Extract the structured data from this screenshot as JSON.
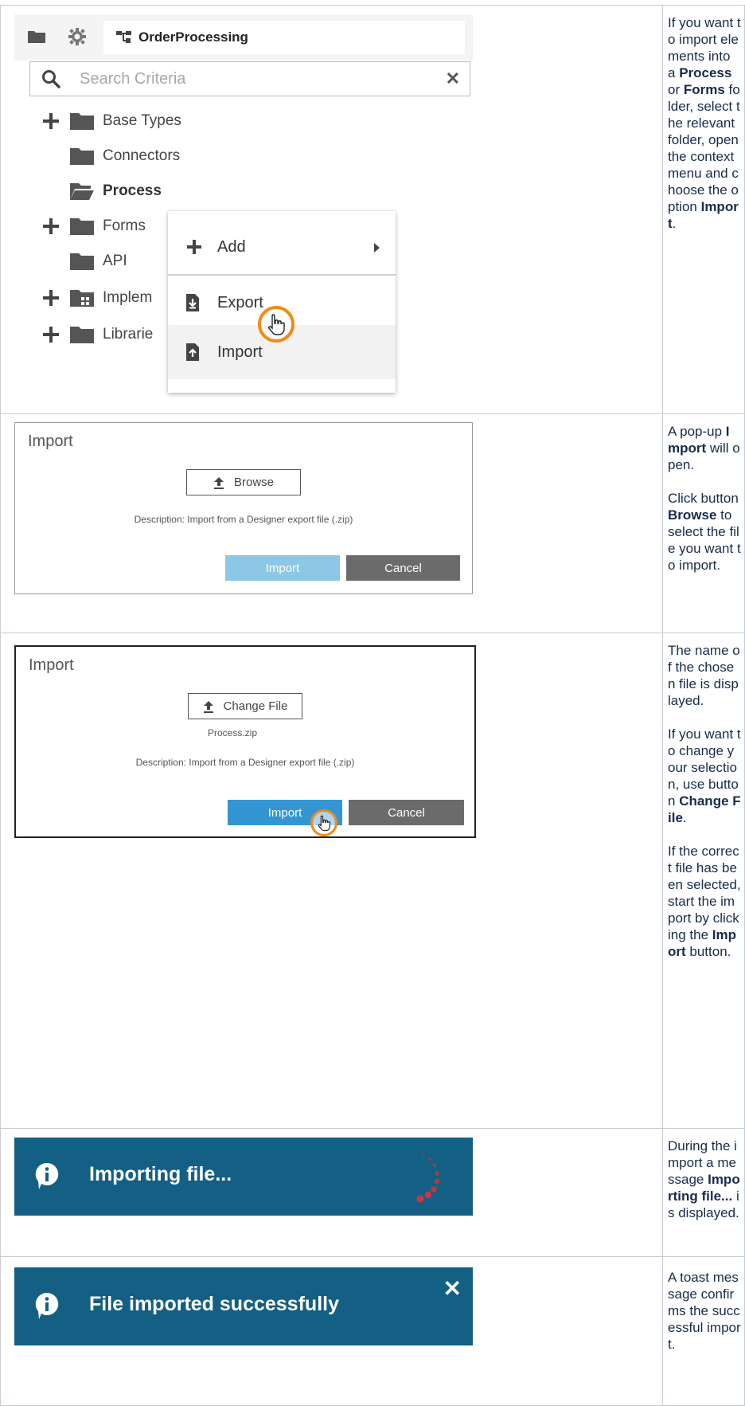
{
  "step1": {
    "tree": {
      "title": "OrderProcessing",
      "search_placeholder": "Search Criteria",
      "items": [
        {
          "label": "Base Types",
          "expandable": true,
          "icon": "folder-icon",
          "bold": false
        },
        {
          "label": "Connectors",
          "expandable": false,
          "icon": "folder-icon",
          "bold": false
        },
        {
          "label": "Process",
          "expandable": false,
          "icon": "folder-open-icon",
          "bold": true
        },
        {
          "label": "Forms",
          "expandable": true,
          "icon": "folder-icon",
          "bold": false
        },
        {
          "label": "API",
          "expandable": false,
          "icon": "folder-icon",
          "bold": false
        },
        {
          "label": "Implem",
          "expandable": true,
          "icon": "folder-grid-icon",
          "bold": false
        },
        {
          "label": "Librarie",
          "expandable": true,
          "icon": "folder-icon",
          "bold": false
        }
      ]
    },
    "context_menu": {
      "add_label": "Add",
      "export_label": "Export",
      "import_label": "Import"
    },
    "description": {
      "t1": "If you want to import elements into a ",
      "b1": "Process",
      "t2": " or ",
      "b2": "Forms",
      "t3": " folder, select the relevant folder, open the context menu and choose the option ",
      "b3": "Import",
      "t4": "."
    }
  },
  "step2": {
    "dialog": {
      "title": "Import",
      "browse_label": "Browse",
      "description_text": "Description: Import from a Designer export file (.zip)",
      "import_label": "Import",
      "cancel_label": "Cancel"
    },
    "description": {
      "t1": "A pop-up ",
      "b1": "Import",
      "t2": " will open.",
      "t3": "Click button ",
      "b2": "Browse",
      "t4": " to select the file you want to import."
    }
  },
  "step3": {
    "dialog": {
      "title": "Import",
      "change_label": "Change File",
      "file_name": "Process.zip",
      "description_text": "Description: Import from a Designer export file (.zip)",
      "import_label": "Import",
      "cancel_label": "Cancel"
    },
    "description": {
      "p1": "The name of the chosen file is displayed.",
      "t2": "If you want to change your selection, use button ",
      "b2": "Change File",
      "t3": ".",
      "t4": "If the correct file has been selected, start the import by clicking the ",
      "b4": "Import",
      "t5": " button."
    }
  },
  "step4": {
    "toast": {
      "message": "Importing file..."
    },
    "description": {
      "t1": "During the import a message ",
      "b1": "Importing file...",
      "t2": " is displayed."
    }
  },
  "step5": {
    "toast": {
      "message": "File imported successfully"
    },
    "description": {
      "t1": "A toast message confirms the successful import."
    }
  },
  "colors": {
    "toast_bg": "#145f84",
    "import_btn_disabled": "#8cc7e6",
    "import_btn_active": "#3396d3",
    "cancel_btn": "#6b6b6b",
    "cursor_ring": "#f28a1b",
    "spinner": "#d0343c"
  }
}
